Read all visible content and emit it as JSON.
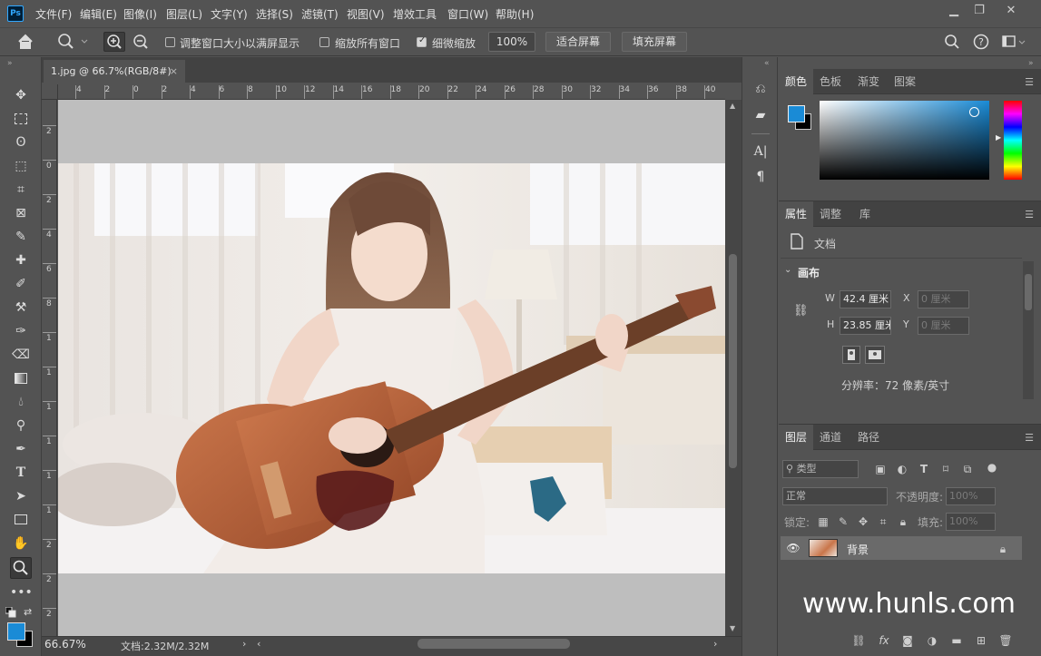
{
  "app": {
    "logo": "Ps"
  },
  "menubar": {
    "items": [
      "文件(F)",
      "编辑(E)",
      "图像(I)",
      "图层(L)",
      "文字(Y)",
      "选择(S)",
      "滤镜(T)",
      "视图(V)",
      "增效工具",
      "窗口(W)",
      "帮助(H)"
    ],
    "window_controls": [
      "minimize-icon",
      "maximize-icon",
      "close-icon"
    ]
  },
  "options": {
    "resize_windows_label": "调整窗口大小以满屏显示",
    "zoom_all_label": "缩放所有窗口",
    "scrubby_zoom_label": "细微缩放",
    "zoom_value": "100%",
    "fit_screen_label": "适合屏幕",
    "fill_screen_label": "填充屏幕"
  },
  "document": {
    "tab_title": "1.jpg @ 66.7%(RGB/8#)",
    "ruler_h_ticks": [
      "4",
      "2",
      "0",
      "2",
      "4",
      "6",
      "8",
      "10",
      "12",
      "14",
      "16",
      "18",
      "20",
      "22",
      "24",
      "26",
      "28",
      "30",
      "32",
      "34",
      "36",
      "38",
      "40"
    ],
    "ruler_v_ticks": [
      "2",
      "0",
      "2",
      "4",
      "6",
      "8",
      "1",
      "1",
      "1",
      "1",
      "1",
      "1",
      "2",
      "2",
      "2"
    ],
    "zoom_status": "66.67%",
    "doc_info": "文档:2.32M/2.32M",
    "watermark": "www.hunls.com"
  },
  "color_panel": {
    "tabs": [
      "颜色",
      "色板",
      "渐变",
      "图案"
    ],
    "foreground": "#1a8bd6",
    "background": "#000000",
    "hue": "#1a8bd6"
  },
  "properties_panel": {
    "tabs": [
      "属性",
      "调整",
      "库"
    ],
    "doc_label": "文档",
    "section": "画布",
    "w_label": "W",
    "w_value": "42.4 厘米",
    "h_label": "H",
    "h_value": "23.85 厘米",
    "x_label": "X",
    "x_placeholder": "0 厘米",
    "y_label": "Y",
    "y_placeholder": "0 厘米",
    "resolution": "分辨率：72 像素/英寸"
  },
  "layers_panel": {
    "tabs": [
      "图层",
      "通道",
      "路径"
    ],
    "filter_label": "类型",
    "blend_mode": "正常",
    "opacity_label": "不透明度:",
    "opacity_value": "100%",
    "lock_label": "锁定:",
    "fill_label": "填充:",
    "fill_value": "100%",
    "layers": [
      {
        "name": "背景",
        "visible": true,
        "locked": true
      }
    ]
  }
}
